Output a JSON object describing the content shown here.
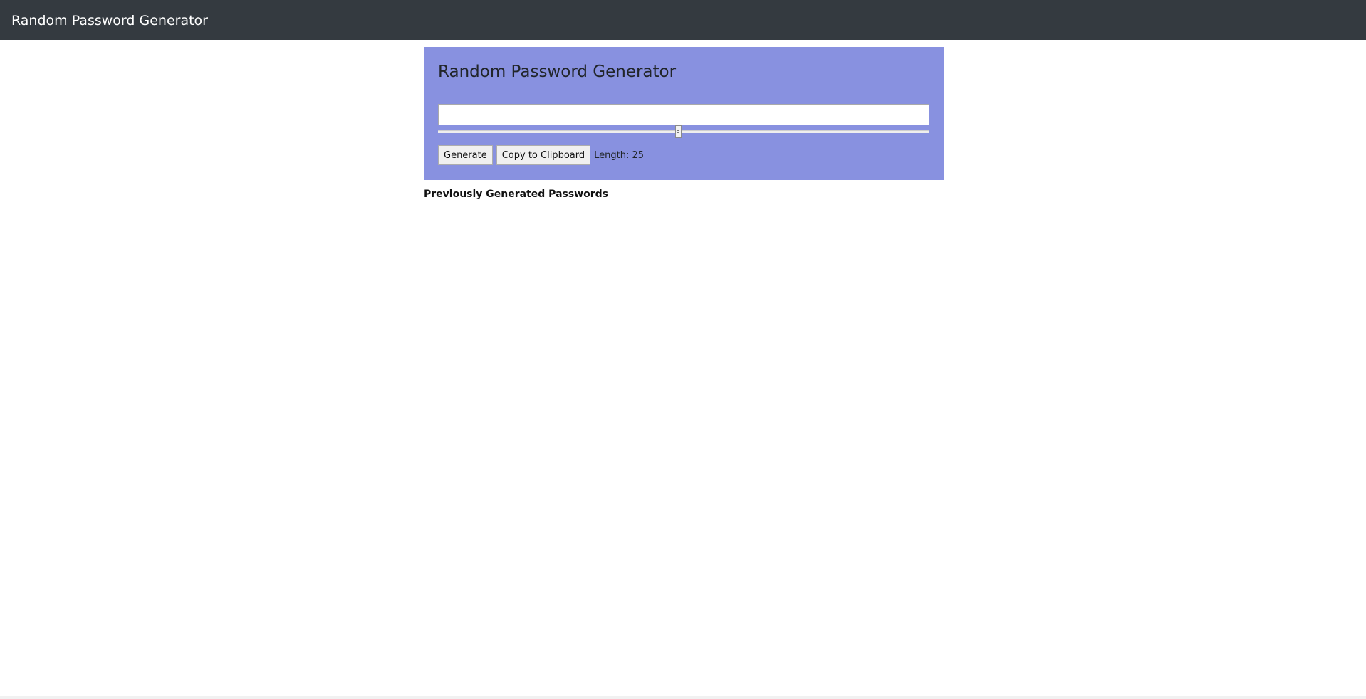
{
  "navbar": {
    "title": "Random Password Generator"
  },
  "panel": {
    "title": "Random Password Generator",
    "password_value": "",
    "length_slider": {
      "value": 25,
      "min": 1,
      "max": 50
    },
    "generate_label": "Generate",
    "copy_label": "Copy to Clipboard",
    "length_text": "Length: 25"
  },
  "history": {
    "heading": "Previously Generated Passwords",
    "items": []
  },
  "colors": {
    "navbar_bg": "#343a40",
    "panel_bg": "#8891e0"
  }
}
